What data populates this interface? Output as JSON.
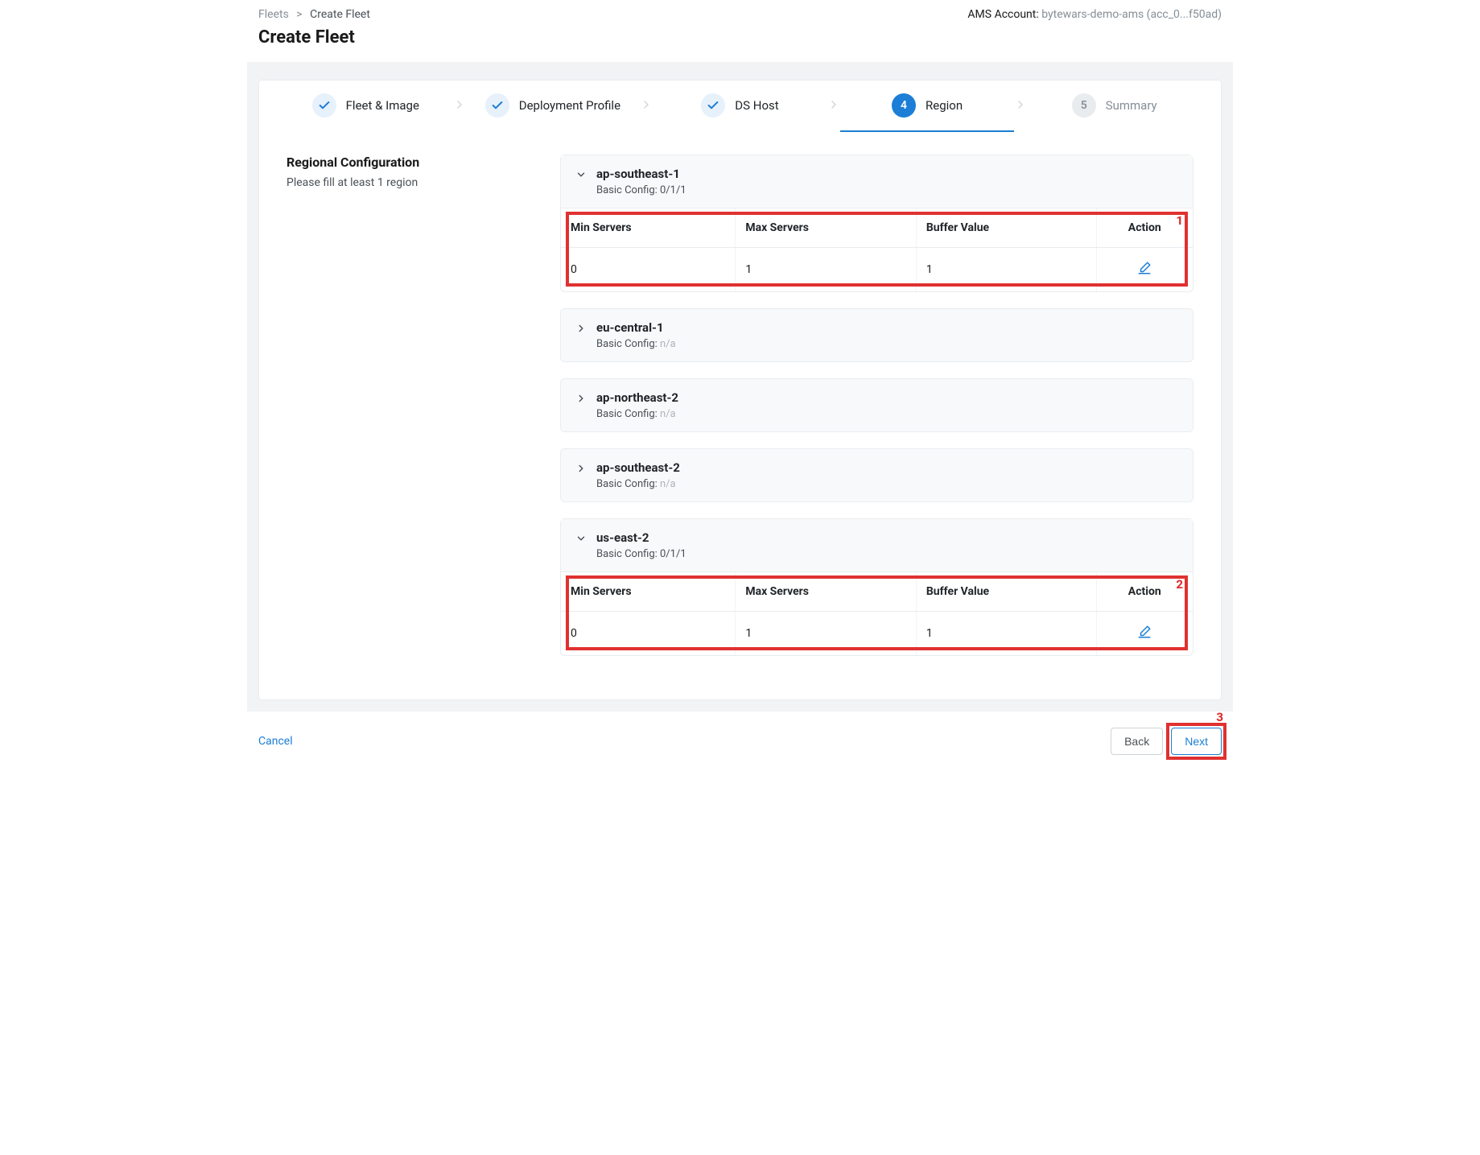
{
  "breadcrumb": {
    "root": "Fleets",
    "current": "Create Fleet"
  },
  "page_title": "Create Fleet",
  "ams": {
    "label": "AMS Account:",
    "value": "bytewars-demo-ams (acc_0...f50ad)"
  },
  "stepper": {
    "steps": [
      {
        "label": "Fleet & Image",
        "state": "done"
      },
      {
        "label": "Deployment Profile",
        "state": "done"
      },
      {
        "label": "DS Host",
        "state": "done"
      },
      {
        "label": "Region",
        "state": "current",
        "num": "4"
      },
      {
        "label": "Summary",
        "state": "upcoming",
        "num": "5"
      }
    ]
  },
  "section": {
    "title": "Regional Configuration",
    "subtitle": "Please fill at least 1 region"
  },
  "table_headers": {
    "min": "Min Servers",
    "max": "Max Servers",
    "buffer": "Buffer Value",
    "action": "Action"
  },
  "basic_config_label": "Basic Config:",
  "regions": [
    {
      "name": "ap-southeast-1",
      "expanded": true,
      "config": "0/1/1",
      "row": {
        "min": "0",
        "max": "1",
        "buffer": "1"
      },
      "highlight": "1"
    },
    {
      "name": "eu-central-1",
      "expanded": false,
      "config": "n/a"
    },
    {
      "name": "ap-northeast-2",
      "expanded": false,
      "config": "n/a"
    },
    {
      "name": "ap-southeast-2",
      "expanded": false,
      "config": "n/a"
    },
    {
      "name": "us-east-2",
      "expanded": true,
      "config": "0/1/1",
      "row": {
        "min": "0",
        "max": "1",
        "buffer": "1"
      },
      "highlight": "2"
    }
  ],
  "footer": {
    "cancel": "Cancel",
    "back": "Back",
    "next": "Next",
    "next_highlight": "3"
  }
}
